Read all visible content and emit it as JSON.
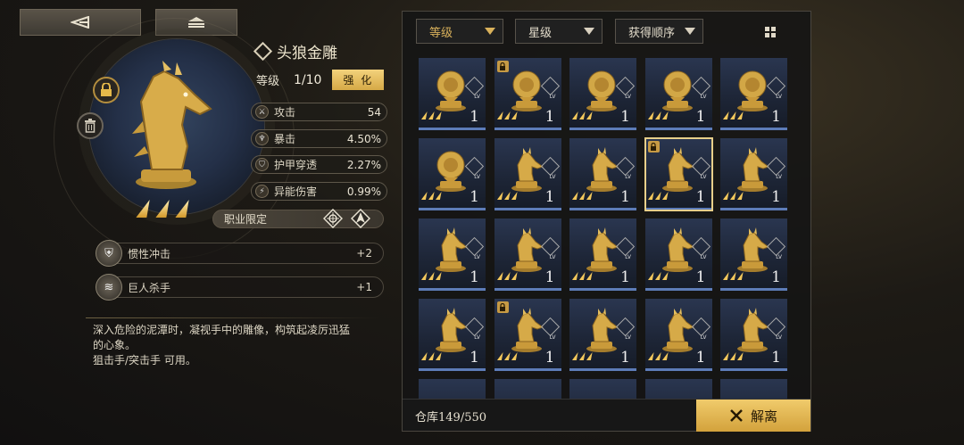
{
  "nav": {
    "back_icon": "back-arrow-icon",
    "home_icon": "home-menu-icon"
  },
  "item": {
    "name": "头狼金雕",
    "level_label": "等级",
    "level_value": "1/10",
    "enhance_label": "强 化",
    "stars": 3,
    "stats": [
      {
        "name": "攻击",
        "value": "54",
        "icon": "sword-icon"
      },
      {
        "name": "暴击",
        "value": "4.50%",
        "icon": "crit-icon"
      },
      {
        "name": "护甲穿透",
        "value": "2.27%",
        "icon": "shield-pierce-icon"
      },
      {
        "name": "异能伤害",
        "value": "0.99%",
        "icon": "ability-icon"
      }
    ],
    "job_restriction_label": "职业限定",
    "perks": [
      {
        "name": "惯性冲击",
        "value": "+2",
        "icon": "inertia-icon"
      },
      {
        "name": "巨人杀手",
        "value": "+1",
        "icon": "giant-slayer-icon"
      }
    ],
    "description": [
      "深入危险的泥潭时，凝视手中的雕像，构筑起凌厉迅猛",
      "的心象。",
      "狙击手/突击手 可用。"
    ]
  },
  "inventory": {
    "filters": [
      {
        "label": "等级"
      },
      {
        "label": "星级"
      },
      {
        "label": "获得顺序"
      }
    ],
    "lv_label": "LV",
    "items": [
      {
        "type": "lion",
        "level": "1",
        "locked": false,
        "selected": false
      },
      {
        "type": "lion",
        "level": "1",
        "locked": true,
        "selected": false
      },
      {
        "type": "lion",
        "level": "1",
        "locked": false,
        "selected": false
      },
      {
        "type": "lion",
        "level": "1",
        "locked": false,
        "selected": false
      },
      {
        "type": "lion",
        "level": "1",
        "locked": false,
        "selected": false
      },
      {
        "type": "lion",
        "level": "1",
        "locked": false,
        "selected": false
      },
      {
        "type": "wolf",
        "level": "1",
        "locked": false,
        "selected": false
      },
      {
        "type": "wolf",
        "level": "1",
        "locked": false,
        "selected": false
      },
      {
        "type": "wolf",
        "level": "1",
        "locked": true,
        "selected": true
      },
      {
        "type": "wolf",
        "level": "1",
        "locked": false,
        "selected": false
      },
      {
        "type": "wolf",
        "level": "1",
        "locked": false,
        "selected": false
      },
      {
        "type": "wolf",
        "level": "1",
        "locked": false,
        "selected": false
      },
      {
        "type": "wolf",
        "level": "1",
        "locked": false,
        "selected": false
      },
      {
        "type": "wolf",
        "level": "1",
        "locked": false,
        "selected": false
      },
      {
        "type": "wolf",
        "level": "1",
        "locked": false,
        "selected": false
      },
      {
        "type": "wolf",
        "level": "1",
        "locked": false,
        "selected": false
      },
      {
        "type": "wolf",
        "level": "1",
        "locked": true,
        "selected": false
      },
      {
        "type": "wolf",
        "level": "1",
        "locked": false,
        "selected": false
      },
      {
        "type": "wolf",
        "level": "1",
        "locked": false,
        "selected": false
      },
      {
        "type": "wolf",
        "level": "1",
        "locked": false,
        "selected": false
      }
    ],
    "storage_label": "仓库149/550",
    "dismantle_label": "解离"
  },
  "colors": {
    "gold": "#d9b15b",
    "card_bottom": "#5d7cb8",
    "selected_outline": "#e8cf8a"
  }
}
